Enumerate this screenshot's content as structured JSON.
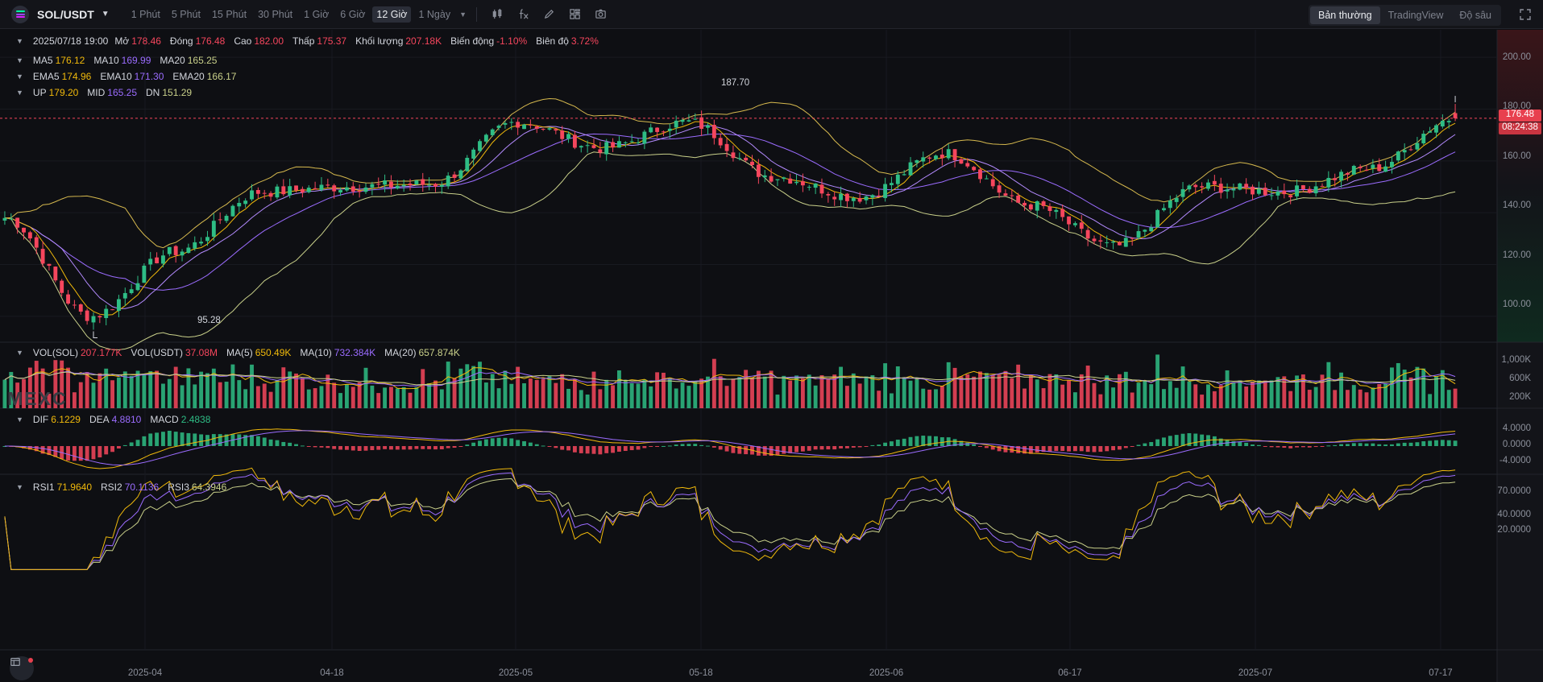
{
  "toolbar": {
    "symbol": "SOL/USDT",
    "intervals": [
      "1 Phút",
      "5 Phút",
      "15 Phút",
      "30 Phút",
      "1 Giờ",
      "6 Giờ",
      "12 Giờ",
      "1 Ngày"
    ],
    "active_interval": "12 Giờ",
    "views": [
      "Bản thường",
      "TradingView",
      "Độ sâu"
    ],
    "active_view": "Bản thường"
  },
  "ohlc_legend": {
    "date": "2025/07/18 19:00",
    "open_label": "Mở",
    "open": "178.46",
    "close_label": "Đóng",
    "close": "176.48",
    "high_label": "Cao",
    "high": "182.00",
    "low_label": "Thấp",
    "low": "175.37",
    "volume_label": "Khối lượng",
    "volume": "207.18K",
    "change_label": "Biến động",
    "change": "-1.10%",
    "amplitude_label": "Biên độ",
    "amplitude": "3.72%"
  },
  "ma_legend": {
    "ma5_label": "MA5",
    "ma5": "176.12",
    "ma10_label": "MA10",
    "ma10": "169.99",
    "ma20_label": "MA20",
    "ma20": "165.25"
  },
  "ema_legend": {
    "ema5_label": "EMA5",
    "ema5": "174.96",
    "ema10_label": "EMA10",
    "ema10": "171.30",
    "ema20_label": "EMA20",
    "ema20": "166.17"
  },
  "boll_legend": {
    "up_label": "UP",
    "up": "179.20",
    "mid_label": "MID",
    "mid": "165.25",
    "dn_label": "DN",
    "dn": "151.29"
  },
  "vol_legend": {
    "vol_sol_label": "VOL(SOL)",
    "vol_sol": "207.177K",
    "vol_usdt_label": "VOL(USDT)",
    "vol_usdt": "37.08M",
    "ma5_label": "MA(5)",
    "ma5": "650.49K",
    "ma10_label": "MA(10)",
    "ma10": "732.384K",
    "ma20_label": "MA(20)",
    "ma20": "657.874K"
  },
  "macd_legend": {
    "dif_label": "DIF",
    "dif": "6.1229",
    "dea_label": "DEA",
    "dea": "4.8810",
    "macd_label": "MACD",
    "macd": "2.4838"
  },
  "rsi_legend": {
    "rsi1_label": "RSI1",
    "rsi1": "71.9640",
    "rsi2_label": "RSI2",
    "rsi2": "70.1136",
    "rsi3_label": "RSI3",
    "rsi3": "64.3946"
  },
  "price_axis": [
    "200.00",
    "180.00",
    "160.00",
    "140.00",
    "120.00",
    "100.00"
  ],
  "volume_axis": [
    "1,000K",
    "600K",
    "200K"
  ],
  "macd_axis": [
    "4.0000",
    "0.0000",
    "-4.0000"
  ],
  "rsi_axis": [
    "70.0000",
    "40.0000",
    "20.0000"
  ],
  "current_price": "176.48",
  "countdown": "08:24:38",
  "period_high": "187.70",
  "period_low": "95.28",
  "watermark": "MEXC",
  "x_axis": [
    "2025-04",
    "04-18",
    "2025-05",
    "05-18",
    "2025-06",
    "06-17",
    "2025-07",
    "07-17"
  ],
  "colors": {
    "up": "#2ebd85",
    "down": "#f6465d",
    "ma5": "#f0b90b",
    "ma10": "#9b6cff",
    "ma20": "#c9d08a",
    "boll": "#d6b94e",
    "price_line": "#f6465d"
  },
  "chart_data": {
    "type": "candlestick",
    "interval": "12h",
    "price_ylim": [
      90,
      210
    ],
    "anchors": {
      "x": [
        "2025-03-26",
        "2025-04-07",
        "2025-04-16",
        "2025-04-23",
        "2025-05-01",
        "2025-05-09",
        "2025-05-15",
        "2025-05-21",
        "2025-05-27",
        "2025-06-03",
        "2025-06-09",
        "2025-06-15",
        "2025-06-22",
        "2025-06-28",
        "2025-07-05",
        "2025-07-11",
        "2025-07-18"
      ],
      "close": [
        138,
        100,
        125,
        148,
        150,
        151,
        175,
        165,
        175,
        154,
        146,
        163,
        143,
        127,
        150,
        148,
        157,
        176.48
      ]
    },
    "period_high": 187.7,
    "period_low": 95.28,
    "last": {
      "open": 178.46,
      "close": 176.48,
      "high": 182.0,
      "low": 175.37
    }
  }
}
